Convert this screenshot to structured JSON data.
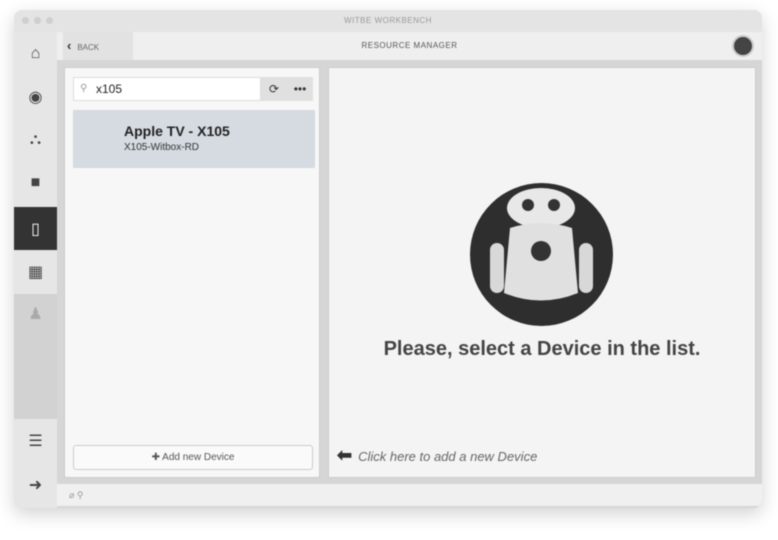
{
  "window": {
    "title": "WITBE WORKBENCH"
  },
  "sidebar": {
    "items": [
      "home",
      "eye",
      "network",
      "video",
      "device",
      "calendar",
      "user",
      "checklist",
      "logout"
    ]
  },
  "header": {
    "back_label": "BACK",
    "title": "RESOURCE MANAGER"
  },
  "search": {
    "value": "x105"
  },
  "devices": [
    {
      "name": "Apple TV - X105",
      "subtitle": "X105-Witbox-RD"
    }
  ],
  "add_button": "Add new Device",
  "empty": {
    "message": "Please, select a Device in the list.",
    "hint": "Click here to add a new Device"
  },
  "footer": {
    "text": "⌀ ⚲"
  }
}
